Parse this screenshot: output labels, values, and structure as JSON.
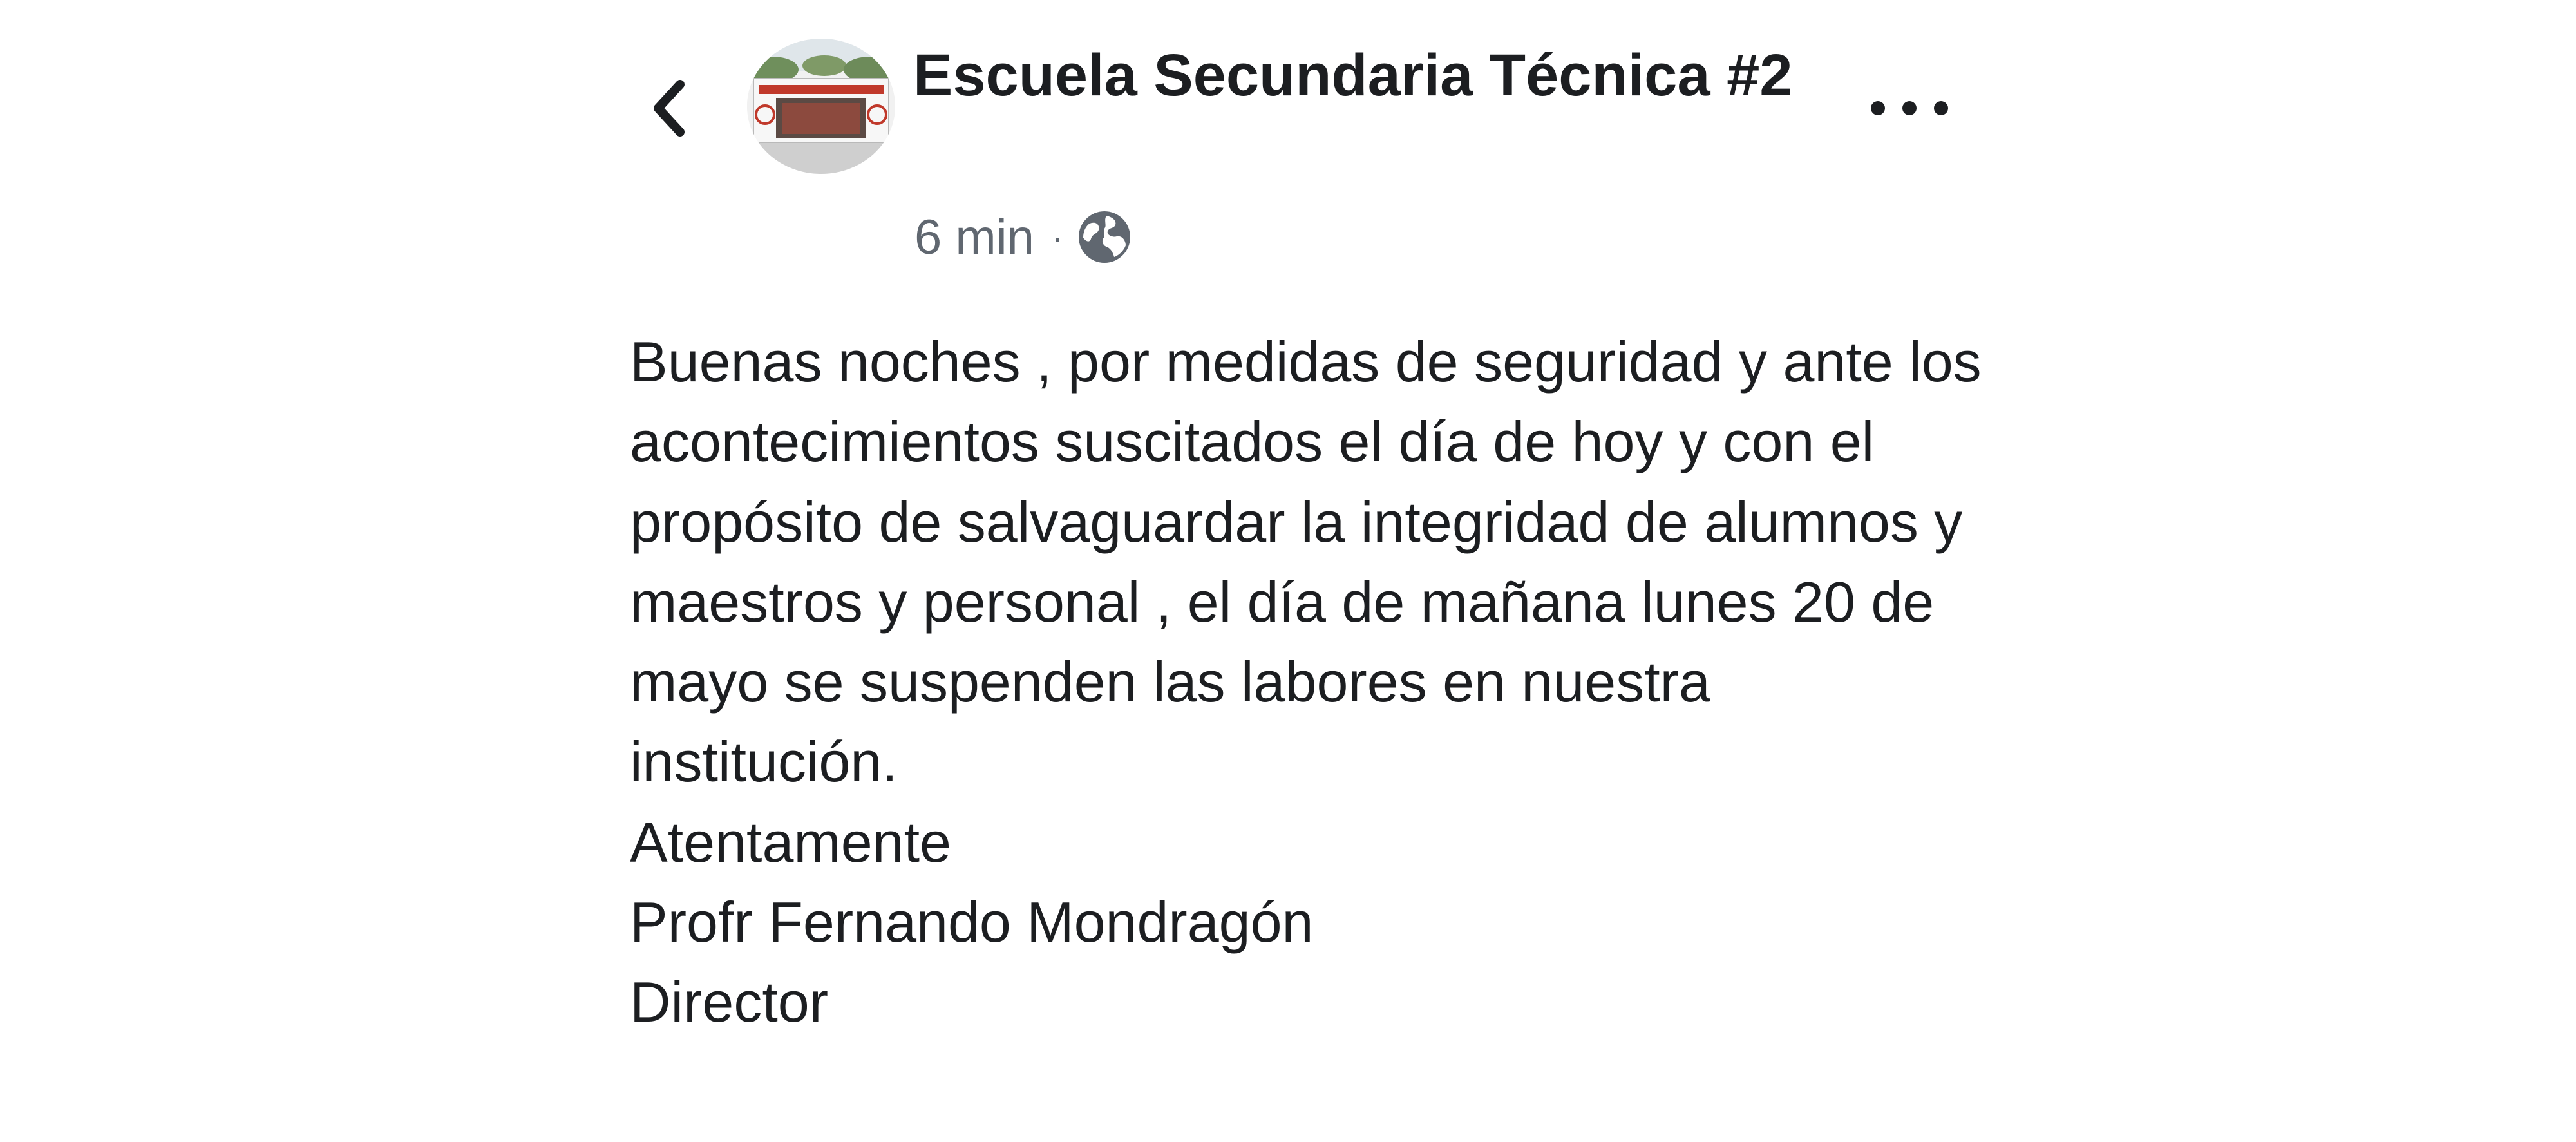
{
  "post": {
    "page_name": "Escuela Secundaria Técnica #2",
    "time": "6 min",
    "separator": "·",
    "privacy_icon": "globe-icon",
    "back_icon": "chevron-left-icon",
    "more_icon": "more-horizontal-icon",
    "body_paragraph": "Buenas noches , por medidas de seguridad y ante los acontecimientos suscitados el día de hoy y con el propósito de salvaguardar la integridad de alumnos y maestros y personal , el día de mañana lunes 20 de mayo se suspenden las labores en nuestra institución.",
    "closing": "Atentamente",
    "signer_name": "Profr Fernando Mondragón",
    "signer_title": "Director"
  },
  "colors": {
    "text": "#1c1e21",
    "meta": "#606770",
    "avatar_banner": "#c0392b"
  }
}
